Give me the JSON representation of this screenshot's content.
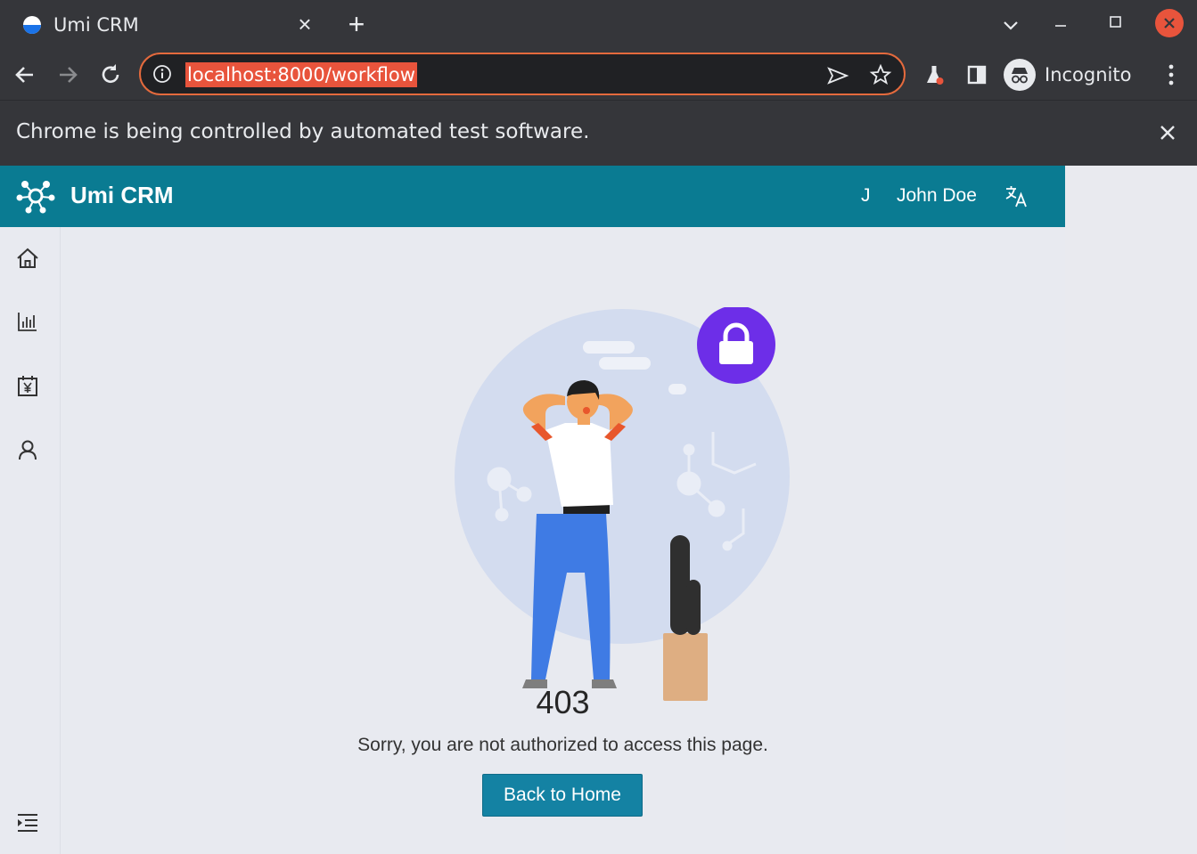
{
  "browser": {
    "tab_title": "Umi CRM",
    "url": "localhost:8000/workflow",
    "profile_label": "Incognito",
    "infobar_message": "Chrome is being controlled by automated test software."
  },
  "app": {
    "title": "Umi CRM",
    "user_initial": "J",
    "user_name": "John Doe",
    "brand_color": "#0a7b92",
    "sidebar_items": [
      "home-icon",
      "chart-icon",
      "calendar-yen-icon",
      "user-icon"
    ]
  },
  "error": {
    "code": "403",
    "message": "Sorry, you are not authorized to access this page.",
    "button_label": "Back to Home"
  }
}
